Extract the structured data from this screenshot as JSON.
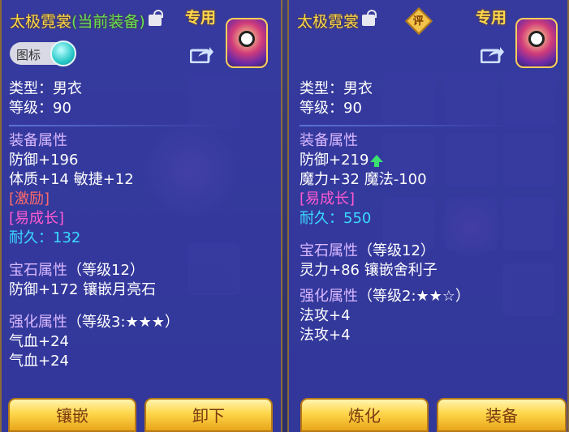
{
  "left_panel": {
    "title": "太极霓裳",
    "equipped_tag": "(当前装备)",
    "exclusive_label": "专用",
    "icon_toggle_label": "图标",
    "type_line": "类型：男衣",
    "level_line": "等级：90",
    "equip_attr_header": "装备属性",
    "equip_attrs": [
      "防御+196",
      "体质+14 敏捷+12"
    ],
    "special_inspire": "[激励]",
    "special_growth": "[易成长]",
    "durability_label": "耐久：",
    "durability_value": "132",
    "gem_header": "宝石属性",
    "gem_level": "（等级12）",
    "gem_attr": "防御+172 镶嵌月亮石",
    "enhance_header": "强化属性",
    "enhance_level": "（等级3:★★★）",
    "enhance_attrs": [
      "气血+24",
      "气血+24"
    ],
    "buttons": [
      "镶嵌",
      "卸下"
    ]
  },
  "right_panel": {
    "title": "太极霓裳",
    "review_badge": "评",
    "exclusive_label": "专用",
    "type_line": "类型：男衣",
    "level_line": "等级：90",
    "equip_attr_header": "装备属性",
    "equip_attrs": [
      "防御+219",
      "魔力+32 魔法-100"
    ],
    "special_growth": "[易成长]",
    "durability_label": "耐久：",
    "durability_value": "550",
    "gem_header": "宝石属性",
    "gem_level": "（等级12）",
    "gem_attr": "灵力+86 镶嵌舍利子",
    "enhance_header": "强化属性",
    "enhance_level": "（等级2:★★☆）",
    "enhance_attrs": [
      "法攻+4",
      "法攻+4"
    ],
    "buttons": [
      "炼化",
      "装备"
    ]
  },
  "colors": {
    "panel_bg": "#3438a8",
    "title": "#ffd84a",
    "equipped": "#63e35a",
    "section_header": "#d9b8ff",
    "inspire": "#ff6a6a",
    "growth": "#ff5ad0",
    "durability": "#3ad9ff",
    "button": "#ffd64a"
  },
  "icons": {
    "lock": "lock-icon",
    "share": "share-icon",
    "stat_up": "up-arrow-icon",
    "avatar": "mask-avatar"
  }
}
